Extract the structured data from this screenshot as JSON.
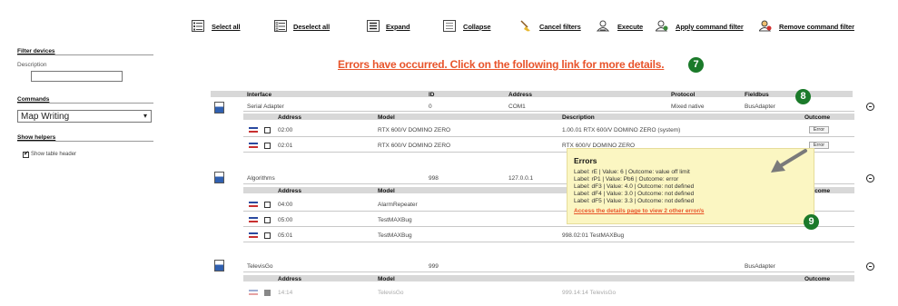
{
  "toolbar": {
    "select_all": "Select all",
    "deselect_all": "Deselect all",
    "expand": "Expand",
    "collapse": "Collapse",
    "cancel_filters": "Cancel filters",
    "execute": "Execute",
    "apply_command_filter": "Apply command filter",
    "remove_command_filter": "Remove command filter"
  },
  "sidebar": {
    "filter_devices": "Filter devices",
    "description_label": "Description",
    "description_value": "",
    "commands_label": "Commands",
    "commands_selected": "Map Writing",
    "show_helpers": "Show helpers",
    "show_table_header": "Show table header"
  },
  "error_banner": "Errors have occurred. Click on the following link for more details.",
  "badges": {
    "b7": "7",
    "b8": "8",
    "b9": "9"
  },
  "table_header": {
    "interface": "Interface",
    "id": "ID",
    "address": "Address",
    "protocol": "Protocol",
    "fieldbus": "Fieldbus"
  },
  "sub_header": {
    "address": "Address",
    "model": "Model",
    "description": "Description",
    "outcome": "Outcome"
  },
  "groups": [
    {
      "interface": "Serial Adapter",
      "id": "0",
      "address": "COM1",
      "protocol": "Mixed native",
      "fieldbus": "BusAdapter",
      "rows": [
        {
          "address": "02:00",
          "model": "RTX 600/V DOMINO ZERO",
          "description": "1.00.01 RTX 600/V DOMINO ZERO (system)",
          "outcome": "Error"
        },
        {
          "address": "02:01",
          "model": "RTX 600/V DOMINO ZERO",
          "description": "RTX 600/V DOMINO ZERO",
          "outcome": "Error"
        }
      ]
    },
    {
      "interface": "Algorithms",
      "id": "998",
      "address": "127.0.0.1",
      "protocol": "",
      "fieldbus": "",
      "rows": [
        {
          "address": "04:00",
          "model": "AlarmRepeater",
          "description": "",
          "outcome": ""
        },
        {
          "address": "05:00",
          "model": "TestMAXBug",
          "description": "",
          "outcome": ""
        },
        {
          "address": "05:01",
          "model": "TestMAXBug",
          "description": "998.02:01 TestMAXBug",
          "outcome": ""
        }
      ]
    },
    {
      "interface": "TelevisGo",
      "id": "999",
      "address": "",
      "protocol": "",
      "fieldbus": "BusAdapter",
      "rows": [
        {
          "address": "14:14",
          "model": "TelevisGo",
          "description": "999.14:14 TelevisGo",
          "outcome": ""
        }
      ]
    }
  ],
  "popup": {
    "title": "Errors",
    "lines": [
      "Label:  rE  |  Value:  6  |  Outcome:  value off limit",
      "Label:  rP1  |  Value:  Pb6  |  Outcome:  error",
      "Label:  dF3  |  Value:  4.0  |  Outcome:  not defined",
      "Label:  dF4  |  Value:  3.0  |  Outcome:  not defined",
      "Label:  dF5  |  Value:  3.3  |  Outcome:  not defined"
    ],
    "link": "Access the details page to view 2 other error/s"
  },
  "colors": {
    "banner": "#e8542b",
    "badge": "#1b7a2a",
    "popup_bg": "#fbf6c2",
    "link": "#e8542b"
  }
}
